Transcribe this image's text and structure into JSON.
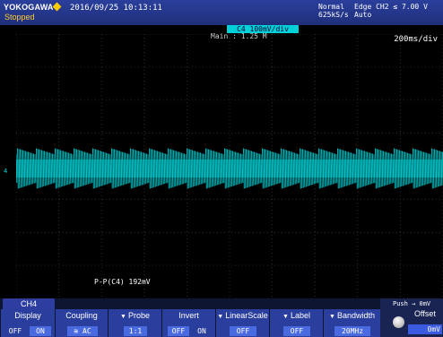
{
  "header": {
    "brand": "YOKOGAWA",
    "status": "Stopped",
    "datetime": "2016/09/25 10:13:11",
    "acq_mode": "Normal",
    "sample_rate": "625kS/s",
    "trigger": "Edge CH2 ≤ 7.00 V",
    "trigger_mode": "Auto"
  },
  "channel_scale": "C4  100mV/div",
  "main_zoom": "Main : 1.25 M",
  "time_div": "200ms/div",
  "measurement": "P-P(C4)  192mV",
  "channel_marker": "4",
  "menu": {
    "tab": "CH4",
    "items": [
      {
        "label": "Display",
        "values": [
          "OFF",
          "ON"
        ],
        "selected": 1
      },
      {
        "label": "Coupling",
        "values": [
          "AC"
        ]
      },
      {
        "label": "Probe",
        "values": [
          "1:1"
        ]
      },
      {
        "label": "Invert",
        "values": [
          "OFF",
          "ON"
        ],
        "selected": 0
      },
      {
        "label": "LinearScale",
        "values": [
          "OFF"
        ]
      },
      {
        "label": "Label",
        "values": [
          "OFF"
        ]
      },
      {
        "label": "Bandwidth",
        "values": [
          "20MHz"
        ]
      }
    ],
    "offset": {
      "push_text": "Push → 0mV",
      "label": "Offset",
      "value": "0mV"
    }
  },
  "colors": {
    "trace": "#00d8dc",
    "grid": "#3a3a3a",
    "header": "#1f2f7a"
  }
}
